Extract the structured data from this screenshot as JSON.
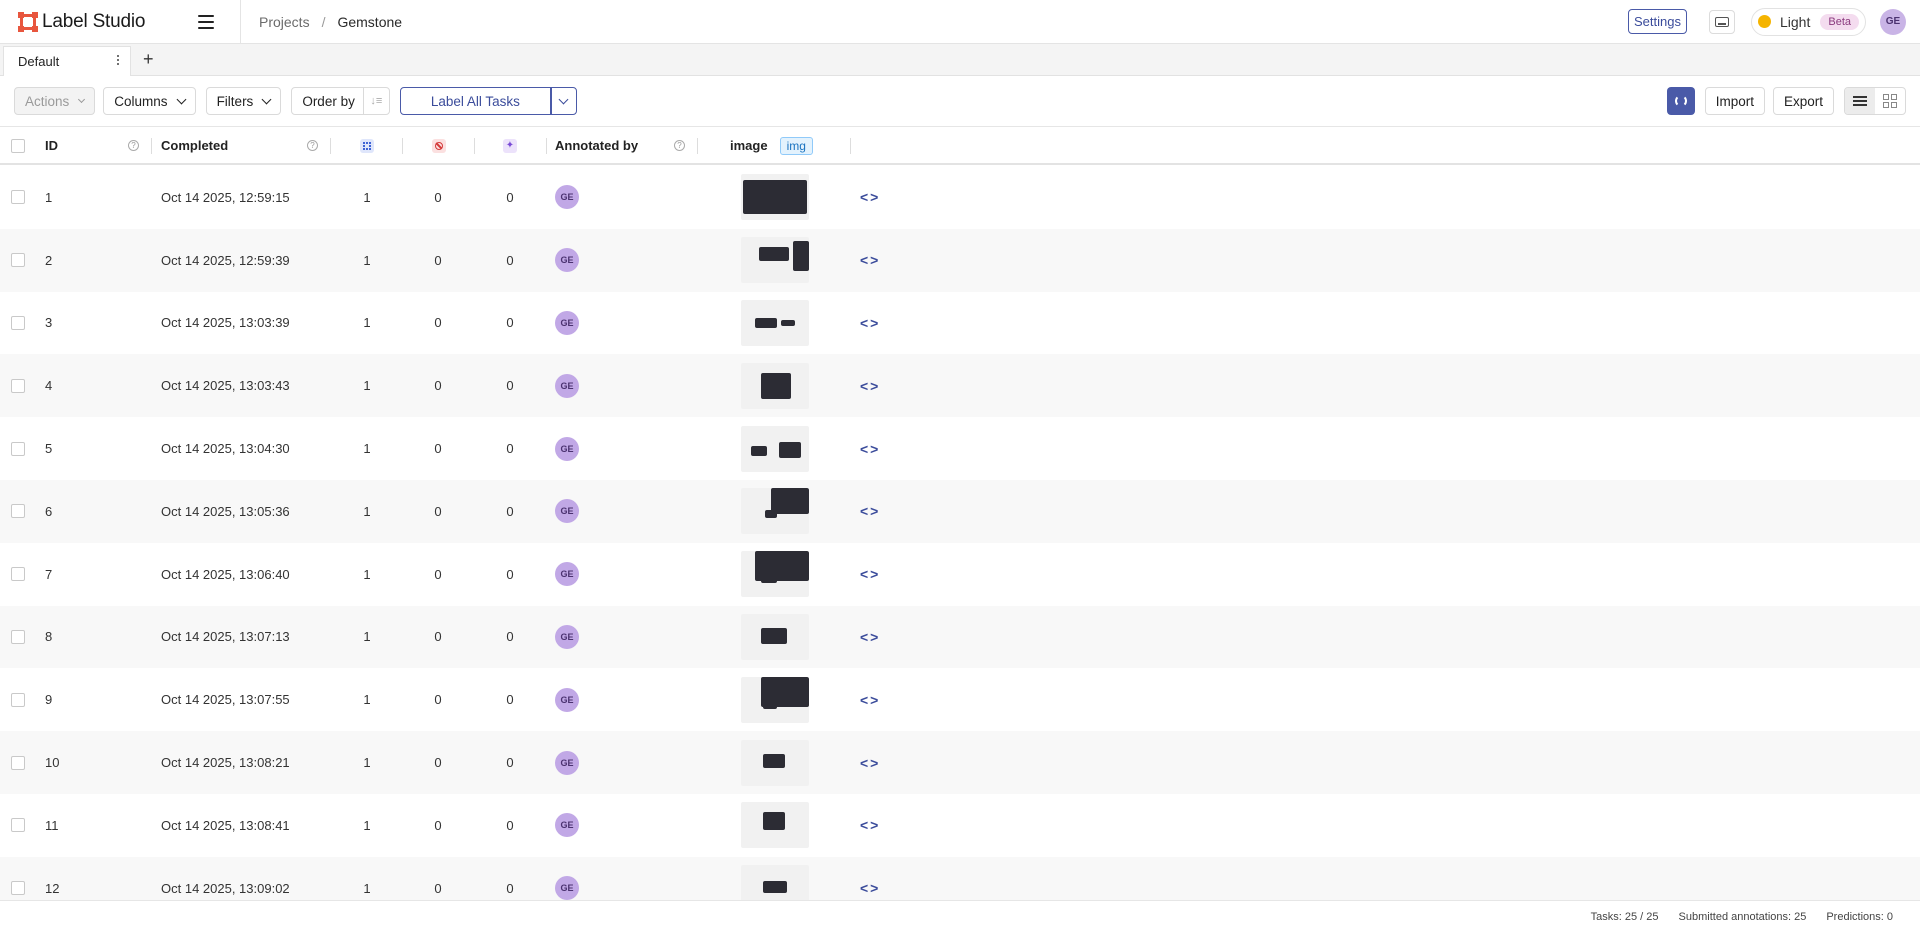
{
  "app": {
    "name": "Label Studio"
  },
  "breadcrumb": {
    "projects": "Projects",
    "separator": "/",
    "current": "Gemstone"
  },
  "header": {
    "settings_label": "Settings",
    "theme_label": "Light",
    "beta_label": "Beta",
    "user_initials": "GE"
  },
  "tabs": [
    {
      "label": "Default"
    }
  ],
  "toolbar": {
    "actions_label": "Actions",
    "columns_label": "Columns",
    "filters_label": "Filters",
    "order_by_label": "Order by",
    "label_all_label": "Label All Tasks",
    "import_label": "Import",
    "export_label": "Export"
  },
  "columns": {
    "id": "ID",
    "completed": "Completed",
    "annotated_by": "Annotated by",
    "image": "image",
    "image_type_tag": "img"
  },
  "rows": [
    {
      "id": "1",
      "completed": "Oct 14 2025, 12:59:15",
      "annotations": "1",
      "cancelled": "0",
      "predictions": "0",
      "annotator": "GE"
    },
    {
      "id": "2",
      "completed": "Oct 14 2025, 12:59:39",
      "annotations": "1",
      "cancelled": "0",
      "predictions": "0",
      "annotator": "GE"
    },
    {
      "id": "3",
      "completed": "Oct 14 2025, 13:03:39",
      "annotations": "1",
      "cancelled": "0",
      "predictions": "0",
      "annotator": "GE"
    },
    {
      "id": "4",
      "completed": "Oct 14 2025, 13:03:43",
      "annotations": "1",
      "cancelled": "0",
      "predictions": "0",
      "annotator": "GE"
    },
    {
      "id": "5",
      "completed": "Oct 14 2025, 13:04:30",
      "annotations": "1",
      "cancelled": "0",
      "predictions": "0",
      "annotator": "GE"
    },
    {
      "id": "6",
      "completed": "Oct 14 2025, 13:05:36",
      "annotations": "1",
      "cancelled": "0",
      "predictions": "0",
      "annotator": "GE"
    },
    {
      "id": "7",
      "completed": "Oct 14 2025, 13:06:40",
      "annotations": "1",
      "cancelled": "0",
      "predictions": "0",
      "annotator": "GE"
    },
    {
      "id": "8",
      "completed": "Oct 14 2025, 13:07:13",
      "annotations": "1",
      "cancelled": "0",
      "predictions": "0",
      "annotator": "GE"
    },
    {
      "id": "9",
      "completed": "Oct 14 2025, 13:07:55",
      "annotations": "1",
      "cancelled": "0",
      "predictions": "0",
      "annotator": "GE"
    },
    {
      "id": "10",
      "completed": "Oct 14 2025, 13:08:21",
      "annotations": "1",
      "cancelled": "0",
      "predictions": "0",
      "annotator": "GE"
    },
    {
      "id": "11",
      "completed": "Oct 14 2025, 13:08:41",
      "annotations": "1",
      "cancelled": "0",
      "predictions": "0",
      "annotator": "GE"
    },
    {
      "id": "12",
      "completed": "Oct 14 2025, 13:09:02",
      "annotations": "1",
      "cancelled": "0",
      "predictions": "0",
      "annotator": "GE"
    }
  ],
  "footer": {
    "tasks": "Tasks: 25 / 25",
    "submitted": "Submitted annotations: 25",
    "predictions": "Predictions: 0"
  },
  "colors": {
    "accent": "#4a5aa8",
    "brand": "#e8563e",
    "avatar": "#c1a8e6"
  }
}
